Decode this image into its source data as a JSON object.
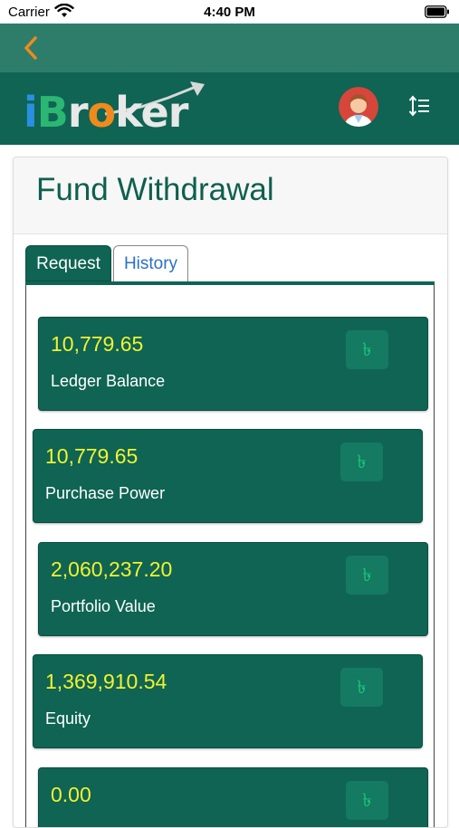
{
  "status_bar": {
    "carrier": "Carrier",
    "time": "4:40 PM"
  },
  "nav": {
    "back_icon": "chevron-left-icon"
  },
  "header": {
    "logo_text": "iBroker",
    "avatar_icon": "user-avatar",
    "menu_icon": "sort-list-icon"
  },
  "page": {
    "title": "Fund Withdrawal"
  },
  "tabs": [
    {
      "label": "Request",
      "active": true
    },
    {
      "label": "History",
      "active": false
    }
  ],
  "balances": [
    {
      "value": "10,779.65",
      "label": "Ledger Balance",
      "icon": "taka-icon"
    },
    {
      "value": "10,779.65",
      "label": "Purchase Power",
      "icon": "taka-icon"
    },
    {
      "value": "2,060,237.20",
      "label": "Portfolio Value",
      "icon": "taka-icon"
    },
    {
      "value": "1,369,910.54",
      "label": "Equity",
      "icon": "taka-icon"
    },
    {
      "value": "0.00",
      "label": "",
      "icon": "taka-icon"
    }
  ],
  "colors": {
    "nav": "#2e7d6b",
    "header": "#0f6453",
    "value_yellow": "#f2f230",
    "accent_orange": "#f08a1c",
    "taka_green": "#1ecb7a",
    "history_tab_text": "#2a6fc9"
  }
}
